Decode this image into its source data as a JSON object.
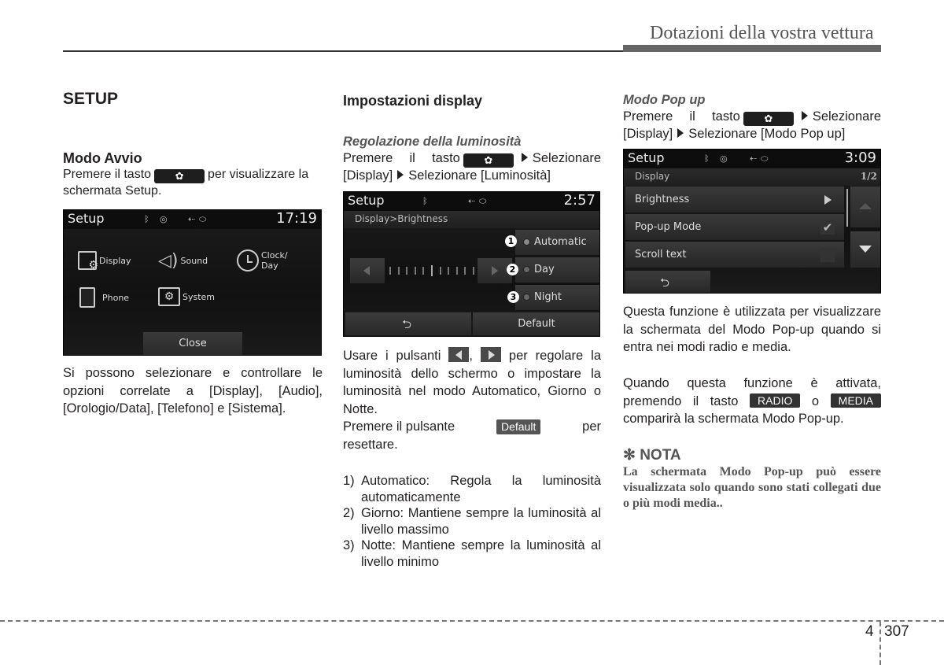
{
  "header": {
    "section_title": "Dotazioni della vostra vettura"
  },
  "col1": {
    "title": "SETUP",
    "subtitle": "Modo Avvio",
    "intro_pre": "Premere il tasto",
    "intro_post": "per visualizzare la schermata Setup.",
    "screen": {
      "title": "Setup",
      "time": "17:19",
      "status_icons": [
        "bluetooth-icon",
        "disc-icon",
        "usb-icon",
        "aux-icon"
      ],
      "items": [
        {
          "label": "Display",
          "icon": "display-settings-icon"
        },
        {
          "label": "Sound",
          "icon": "speaker-icon"
        },
        {
          "label": "Clock/ Day",
          "icon": "clock-icon"
        },
        {
          "label": "Phone",
          "icon": "phone-icon"
        },
        {
          "label": "System",
          "icon": "system-folder-icon"
        }
      ],
      "close_label": "Close"
    },
    "body": "Si possono selezionare e controllare le opzioni correlate a [Display], [Audio], [Orologio/Data], [Telefono] e [Sistema]."
  },
  "col2": {
    "title": "Impostazioni display",
    "subtitle": "Regolazione della luminosità",
    "intro_pre": "Premere il tasto",
    "intro_mid": "Selezionare [Display]",
    "intro_post": "Selezionare [Luminosità]",
    "screen": {
      "title": "Setup",
      "time": "2:57",
      "breadcrumb": "Display>Brightness",
      "options": [
        {
          "num": "1",
          "label": "Automatic"
        },
        {
          "num": "2",
          "label": "Day"
        },
        {
          "num": "3",
          "label": "Night"
        }
      ],
      "brightness_level_fraction": 0.5,
      "default_label": "Default"
    },
    "usage_pre": "Usare i pulsanti",
    "usage_sep": ",",
    "usage_post": "per regolare la luminosità dello schermo o impostare la luminosità nel modo Automatico, Giorno o Notte.",
    "reset_pre": "Premere il pulsante",
    "reset_button": "Default",
    "reset_post": "per resettare.",
    "list": [
      {
        "num": "1)",
        "text": "Automatico: Regola la luminosità automaticamente"
      },
      {
        "num": "2)",
        "text": "Giorno: Mantiene sempre la luminosità al livello massimo"
      },
      {
        "num": "3)",
        "text": "Notte: Mantiene sempre la luminosità al livello minimo"
      }
    ]
  },
  "col3": {
    "subtitle": "Modo Pop up",
    "intro_pre": "Premere il tasto",
    "intro_mid": "Selezionare [Display]",
    "intro_post": "Selezionare [Modo Pop up]",
    "screen": {
      "title": "Setup",
      "time": "3:09",
      "breadcrumb": "Display",
      "page": "1/2",
      "rows": [
        {
          "label": "Brightness",
          "control": "arrow"
        },
        {
          "label": "Pop-up Mode",
          "control": "checked"
        },
        {
          "label": "Scroll text",
          "control": "unchecked"
        }
      ]
    },
    "body1": "Questa funzione è utilizzata per visualizzare la schermata del Modo Pop-up quando si entra nei modi radio e media.",
    "body2_pre": "Quando questa funzione è attivata, premendo il tasto",
    "radio_button": "RADIO",
    "body2_or": "o",
    "media_button": "MEDIA",
    "body2_post": "comparirà la schermata Modo Pop-up.",
    "nota_symbol": "✻",
    "nota_title": "NOTA",
    "nota_body": "La schermata Modo Pop-up può essere visualizzata solo quando sono stati collegati due o più modi media.."
  },
  "footer": {
    "section": "4",
    "page": "307"
  }
}
